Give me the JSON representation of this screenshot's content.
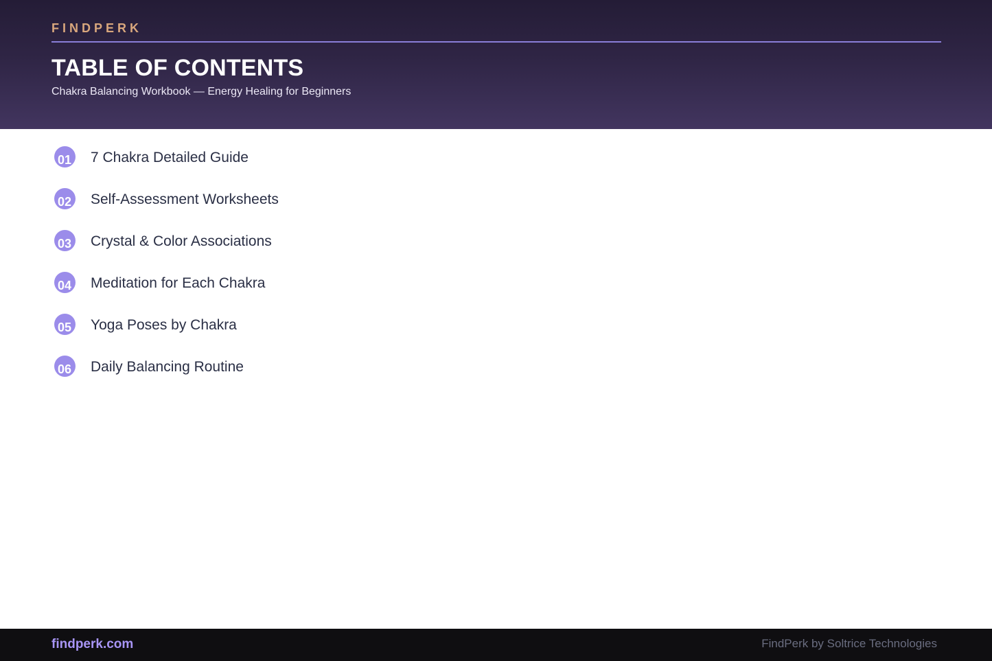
{
  "header": {
    "brand": "FINDPERK",
    "title": "TABLE OF CONTENTS",
    "subtitle": "Chakra Balancing Workbook — Energy Healing for Beginners"
  },
  "toc": {
    "items": [
      {
        "number": "01",
        "label": "7 Chakra Detailed Guide"
      },
      {
        "number": "02",
        "label": "Self-Assessment Worksheets"
      },
      {
        "number": "03",
        "label": "Crystal & Color Associations"
      },
      {
        "number": "04",
        "label": "Meditation for Each Chakra"
      },
      {
        "number": "05",
        "label": "Yoga Poses by Chakra"
      },
      {
        "number": "06",
        "label": "Daily Balancing Routine"
      }
    ]
  },
  "footer": {
    "site": "findperk.com",
    "credit": "FindPerk by Soltrice Technologies"
  },
  "colors": {
    "header_gradient_top": "#241c36",
    "header_gradient_bottom": "#42355f",
    "brand": "#d9a77d",
    "accent": "#9b8cea",
    "footer_bg": "#0f0e11",
    "footer_link": "#a895f5"
  }
}
